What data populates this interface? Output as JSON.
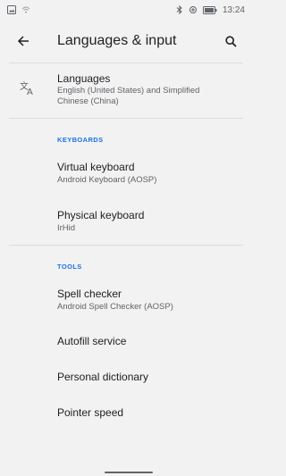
{
  "status_bar": {
    "time": "13:24",
    "icons": [
      "image-icon",
      "wifi-off-icon",
      "bluetooth-icon",
      "data-saver-icon",
      "battery-icon"
    ]
  },
  "app_bar": {
    "title": "Languages & input",
    "back_icon": "back-arrow-icon",
    "search_icon": "search-icon"
  },
  "languages": {
    "title": "Languages",
    "summary_line1": "English (United States) and Simplified",
    "summary_line2": "Chinese (China)",
    "icon": "translate-icon"
  },
  "keyboards": {
    "header": "KEYBOARDS",
    "items": [
      {
        "title": "Virtual keyboard",
        "summary": "Android Keyboard (AOSP)"
      },
      {
        "title": "Physical keyboard",
        "summary": "IrHid"
      }
    ]
  },
  "tools": {
    "header": "TOOLS",
    "items": [
      {
        "title": "Spell checker",
        "summary": "Android Spell Checker (AOSP)"
      },
      {
        "title": "Autofill service",
        "summary": ""
      },
      {
        "title": "Personal dictionary",
        "summary": ""
      },
      {
        "title": "Pointer speed",
        "summary": ""
      }
    ]
  },
  "colors": {
    "background": "#f2f2f2",
    "accent": "#1a73e8",
    "primary_text": "#202124",
    "secondary_text": "#5f6368",
    "divider": "#dadce0"
  }
}
